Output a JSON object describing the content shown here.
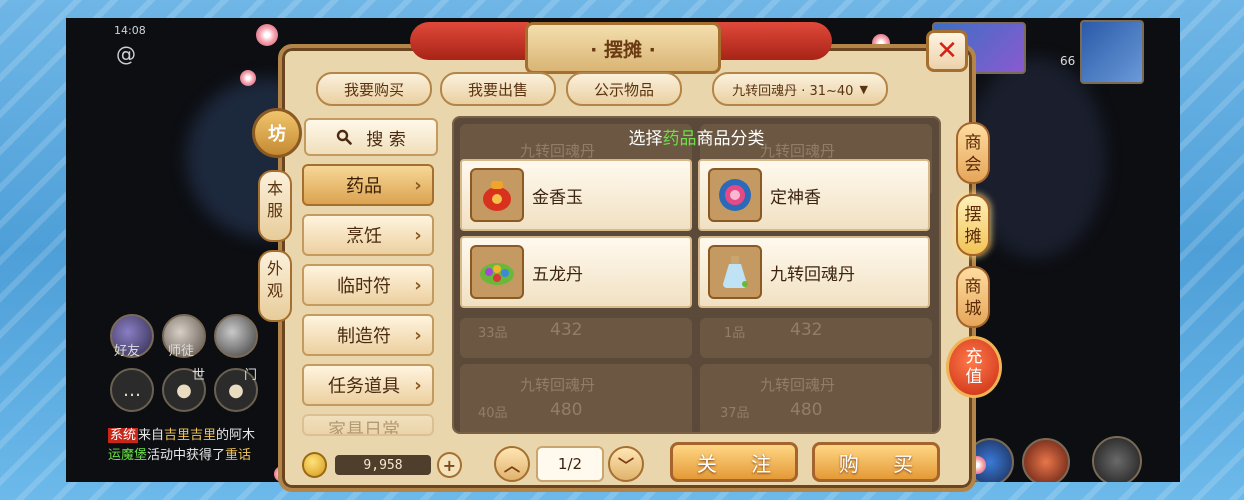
{
  "status_bar": {
    "time": "14:08"
  },
  "hud": {
    "friends_label": "好友",
    "mentor_label": "师徒",
    "world_label": "世",
    "gate_label": "门",
    "level_badge": "66"
  },
  "chat": {
    "line1_tag": "系统",
    "line1_prefix": "来自",
    "line1_game": "吉里吉里",
    "line1_suffix": "的阿木",
    "line2_place": "运魔堡",
    "line2_text": "活动中获得了",
    "line2_item": "重话"
  },
  "panel": {
    "title": "· 摆摊 ·",
    "tabs": [
      "我要购买",
      "我要出售",
      "公示物品"
    ],
    "level_filter": "九转回魂丹 · 31~40",
    "side_round": "坊",
    "side_tags": [
      "本服",
      "外观"
    ],
    "search_label": "搜 索",
    "categories": [
      {
        "label": "药品",
        "active": true
      },
      {
        "label": "烹饪",
        "active": false
      },
      {
        "label": "临时符",
        "active": false
      },
      {
        "label": "制造符",
        "active": false
      },
      {
        "label": "任务道具",
        "active": false
      },
      {
        "label": "家具日常",
        "active": false
      }
    ],
    "overlay_title_prefix": "选择",
    "overlay_title_highlight": "药品",
    "overlay_title_suffix": "商品分类",
    "subcategories": [
      {
        "name": "金香玉",
        "icon": "red-pouch-icon"
      },
      {
        "name": "定神香",
        "icon": "incense-bowl-icon"
      },
      {
        "name": "五龙丹",
        "icon": "pill-leaf-icon"
      },
      {
        "name": "九转回魂丹",
        "icon": "potion-bottle-icon"
      }
    ],
    "bg_listings": [
      {
        "name": "九转回魂丹",
        "qty": "",
        "price": ""
      },
      {
        "name": "九转回魂丹",
        "qty": "",
        "price": ""
      },
      {
        "name": "",
        "qty": "33品",
        "price": "432"
      },
      {
        "name": "",
        "qty": "1品",
        "price": "432"
      },
      {
        "name": "九转回魂丹",
        "qty": "40品",
        "price": "480"
      },
      {
        "name": "九转回魂丹",
        "qty": "37品",
        "price": "480"
      }
    ],
    "coins": "9,958",
    "page": "1/2",
    "follow_label": "关 注",
    "buy_label": "购 买"
  },
  "right_tabs": [
    "商会",
    "摆摊",
    "商城"
  ],
  "charge_label": "充值",
  "colors": {
    "highlight_green": "#6ce04a",
    "close_red": "#d32214",
    "accent_orange": "#e49a37"
  }
}
